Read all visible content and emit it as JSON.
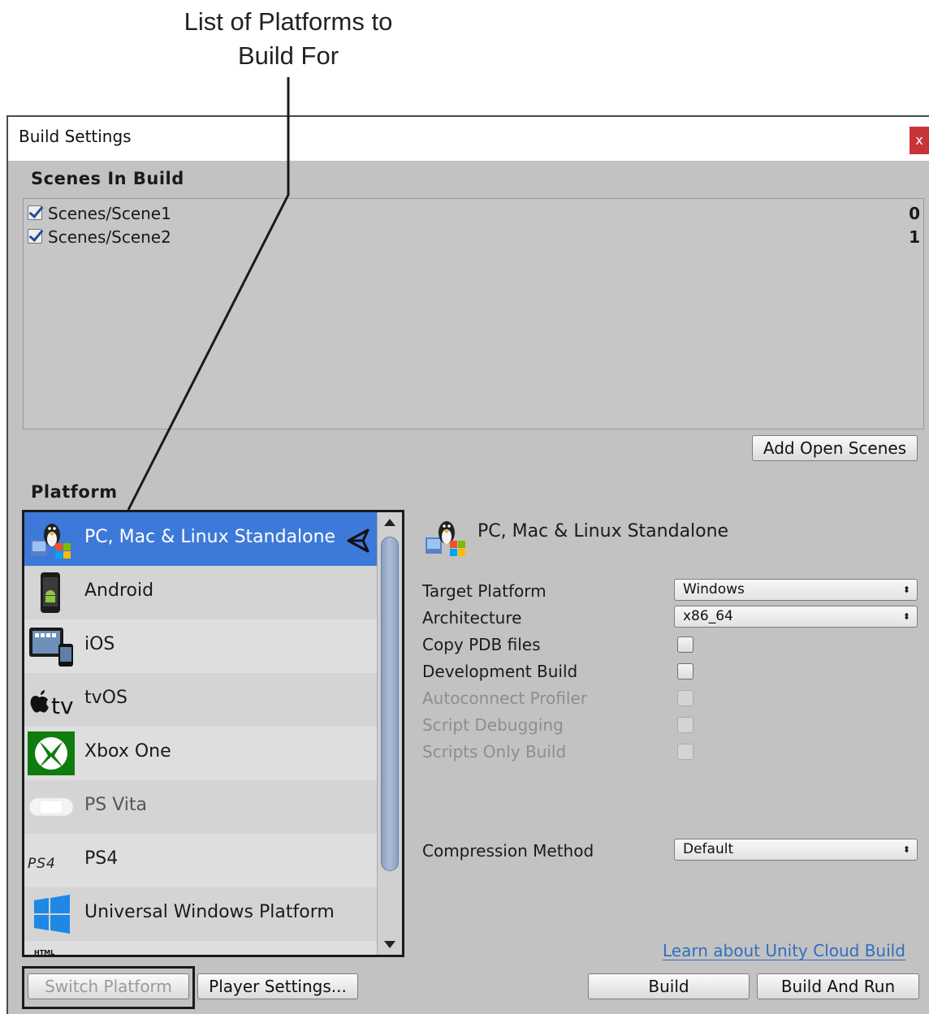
{
  "callout": {
    "line1": "List of Platforms to",
    "line2": "Build For"
  },
  "window": {
    "title": "Build Settings",
    "close_glyph": "x"
  },
  "scenes": {
    "header": "Scenes In Build",
    "items": [
      {
        "checked": true,
        "name": "Scenes/Scene1",
        "index": "0"
      },
      {
        "checked": true,
        "name": "Scenes/Scene2",
        "index": "1"
      }
    ],
    "add_open_scenes_label": "Add Open Scenes"
  },
  "platform": {
    "header": "Platform",
    "items": [
      {
        "label": "PC, Mac & Linux Standalone",
        "icon": "standalone-icon",
        "selected": true,
        "active": true
      },
      {
        "label": "Android",
        "icon": "android-icon"
      },
      {
        "label": "iOS",
        "icon": "ios-icon"
      },
      {
        "label": "tvOS",
        "icon": "tvos-icon",
        "icon_text": "tv"
      },
      {
        "label": "Xbox One",
        "icon": "xbox-icon"
      },
      {
        "label": "PS Vita",
        "icon": "psvita-icon"
      },
      {
        "label": "PS4",
        "icon": "ps4-icon",
        "icon_text": "PS4"
      },
      {
        "label": "Universal Windows Platform",
        "icon": "windows-icon"
      },
      {
        "label": "",
        "icon": "html-icon",
        "icon_text": "HTML"
      }
    ]
  },
  "details": {
    "platform_name": "PC, Mac & Linux Standalone",
    "target_platform": {
      "label": "Target Platform",
      "value": "Windows"
    },
    "architecture": {
      "label": "Architecture",
      "value": "x86_64"
    },
    "copy_pdb": {
      "label": "Copy PDB files",
      "checked": false
    },
    "development_build": {
      "label": "Development Build",
      "checked": false
    },
    "autoconnect_profiler": {
      "label": "Autoconnect Profiler",
      "enabled": false
    },
    "script_debugging": {
      "label": "Script Debugging",
      "enabled": false
    },
    "scripts_only_build": {
      "label": "Scripts Only Build",
      "enabled": false
    },
    "compression_method": {
      "label": "Compression Method",
      "value": "Default"
    },
    "cloud_build_link": "Learn about Unity Cloud Build"
  },
  "buttons": {
    "switch_platform": "Switch Platform",
    "player_settings": "Player Settings...",
    "build": "Build",
    "build_and_run": "Build And Run"
  },
  "colors": {
    "selection": "#3d79d8",
    "window_bg": "#c2c2c2",
    "close": "#c8343a",
    "link": "#2f6fbf"
  }
}
